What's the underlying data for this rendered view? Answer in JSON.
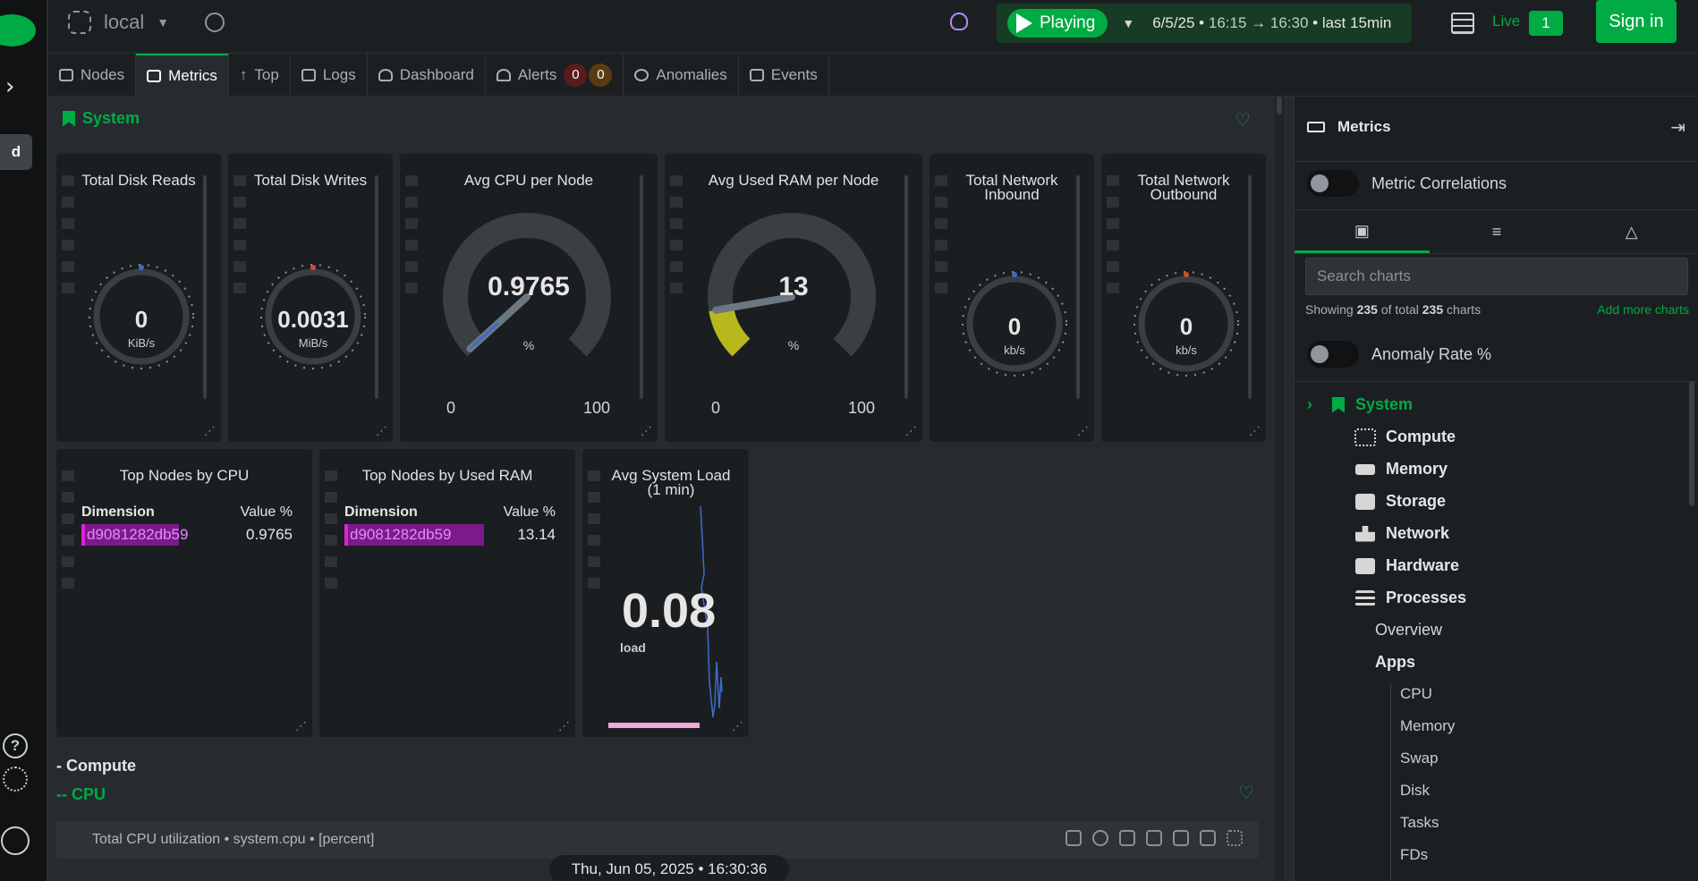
{
  "rail": {
    "space_initial": "d"
  },
  "topbar": {
    "room": "local",
    "playing_label": "Playing",
    "date": "6/5/25",
    "from": "16:15",
    "to": "16:30",
    "last_label": "last",
    "duration": "15min",
    "live_label": "Live",
    "live_count": "1",
    "signin": "Sign in"
  },
  "tabs": [
    {
      "label": "Nodes"
    },
    {
      "label": "Metrics"
    },
    {
      "label": "Top"
    },
    {
      "label": "Logs"
    },
    {
      "label": "Dashboard"
    },
    {
      "label": "Alerts"
    },
    {
      "label": "Anomalies"
    },
    {
      "label": "Events"
    }
  ],
  "alerts": {
    "critical": "0",
    "warning": "0"
  },
  "main": {
    "section": "System",
    "gauges": [
      {
        "title": "Total Disk Reads",
        "value": "0",
        "unit": "KiB/s"
      },
      {
        "title": "Total Disk Writes",
        "value": "0.0031",
        "unit": "MiB/s"
      },
      {
        "title": "Avg CPU per Node",
        "value": "0.9765",
        "unit": "%",
        "min": "0",
        "max": "100",
        "level": 0.9765
      },
      {
        "title": "Avg Used RAM per Node",
        "value": "13",
        "unit": "%",
        "min": "0",
        "max": "100",
        "level": 13
      },
      {
        "title": "Total Network Inbound",
        "value": "0",
        "unit": "kb/s"
      },
      {
        "title": "Total Network Outbound",
        "value": "0",
        "unit": "kb/s"
      }
    ],
    "top_cpu": {
      "title": "Top Nodes by CPU",
      "dim_header": "Dimension",
      "val_header": "Value %",
      "dim": "d9081282db59",
      "value": "0.9765",
      "fill": 0.9765
    },
    "top_ram": {
      "title": "Top Nodes by Used RAM",
      "dim_header": "Dimension",
      "val_header": "Value %",
      "dim": "d9081282db59",
      "value": "13.14",
      "fill": 1.0
    },
    "load": {
      "title": "Avg System Load (1 min)",
      "value": "0.08",
      "unit": "load"
    },
    "compute_heading": "- Compute",
    "cpu_heading": "-- CPU",
    "cpu_chart_label": "Total CPU utilization • system.cpu • [percent]",
    "timestamp": "Thu, Jun 05, 2025 • 16:30:36"
  },
  "panel": {
    "title": "Metrics",
    "correlations": "Metric Correlations",
    "search_placeholder": "Search charts",
    "showing_prefix": "Showing",
    "showing_count": "235",
    "showing_mid": "of total",
    "showing_total": "235",
    "showing_suffix": "charts",
    "add_more": "Add more charts",
    "anomaly": "Anomaly Rate %",
    "tree": {
      "system": "System",
      "sections": [
        "Compute",
        "Memory",
        "Storage",
        "Network",
        "Hardware",
        "Processes"
      ],
      "overview": "Overview",
      "apps": "Apps",
      "apps_items": [
        "CPU",
        "Memory",
        "Swap",
        "Disk",
        "Tasks",
        "FDs"
      ]
    }
  },
  "colors": {
    "accent": "#00ab44",
    "cpu_needle": "#3f6bc9",
    "ram_fill": "#b8b81c",
    "gauge_track": "#3a3f44",
    "bar_fill": "#7b1a8a"
  }
}
